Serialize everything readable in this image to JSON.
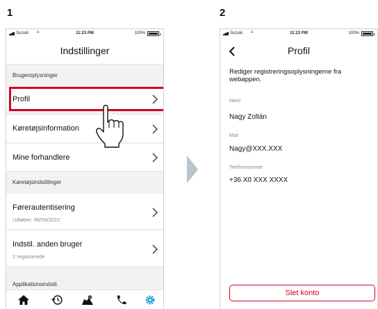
{
  "steps": {
    "first": "1",
    "second": "2"
  },
  "status_bar": {
    "carrier": "Suzuki",
    "time": "11:23 PM",
    "battery": "100%"
  },
  "screen1": {
    "title": "Indstillinger",
    "sections": [
      {
        "header": "Brugeroplysninger"
      },
      {
        "header": "Køretøjsindstillinger"
      },
      {
        "header": "Applikationsindstil."
      }
    ],
    "items": [
      {
        "label": "Profil"
      },
      {
        "label": "Køretøjsinformation"
      },
      {
        "label": "Mine forhandlere"
      },
      {
        "label": "Førerautentisering",
        "sublabel": "Udløber: 06/09/2022"
      },
      {
        "label": "Indstil. anden bruger",
        "sublabel": "2 registrerede"
      }
    ],
    "tabs": [
      "home-icon",
      "history-icon",
      "map-icon",
      "phone-icon",
      "settings-icon"
    ],
    "accent_color": "#d6001c",
    "active_tab_color": "#1fa0d8"
  },
  "screen2": {
    "title": "Profil",
    "intro": "Rediger registreringsoplysningerne fra webappen.",
    "fields": [
      {
        "label": "Navn",
        "value": "Nagy Zoltán"
      },
      {
        "label": "Mail",
        "value": "Nagy@XXX.XXX"
      },
      {
        "label": "Telefonnummer",
        "value": "+36 X0 XXX XXXX"
      }
    ],
    "delete_button": "Slet konto"
  }
}
